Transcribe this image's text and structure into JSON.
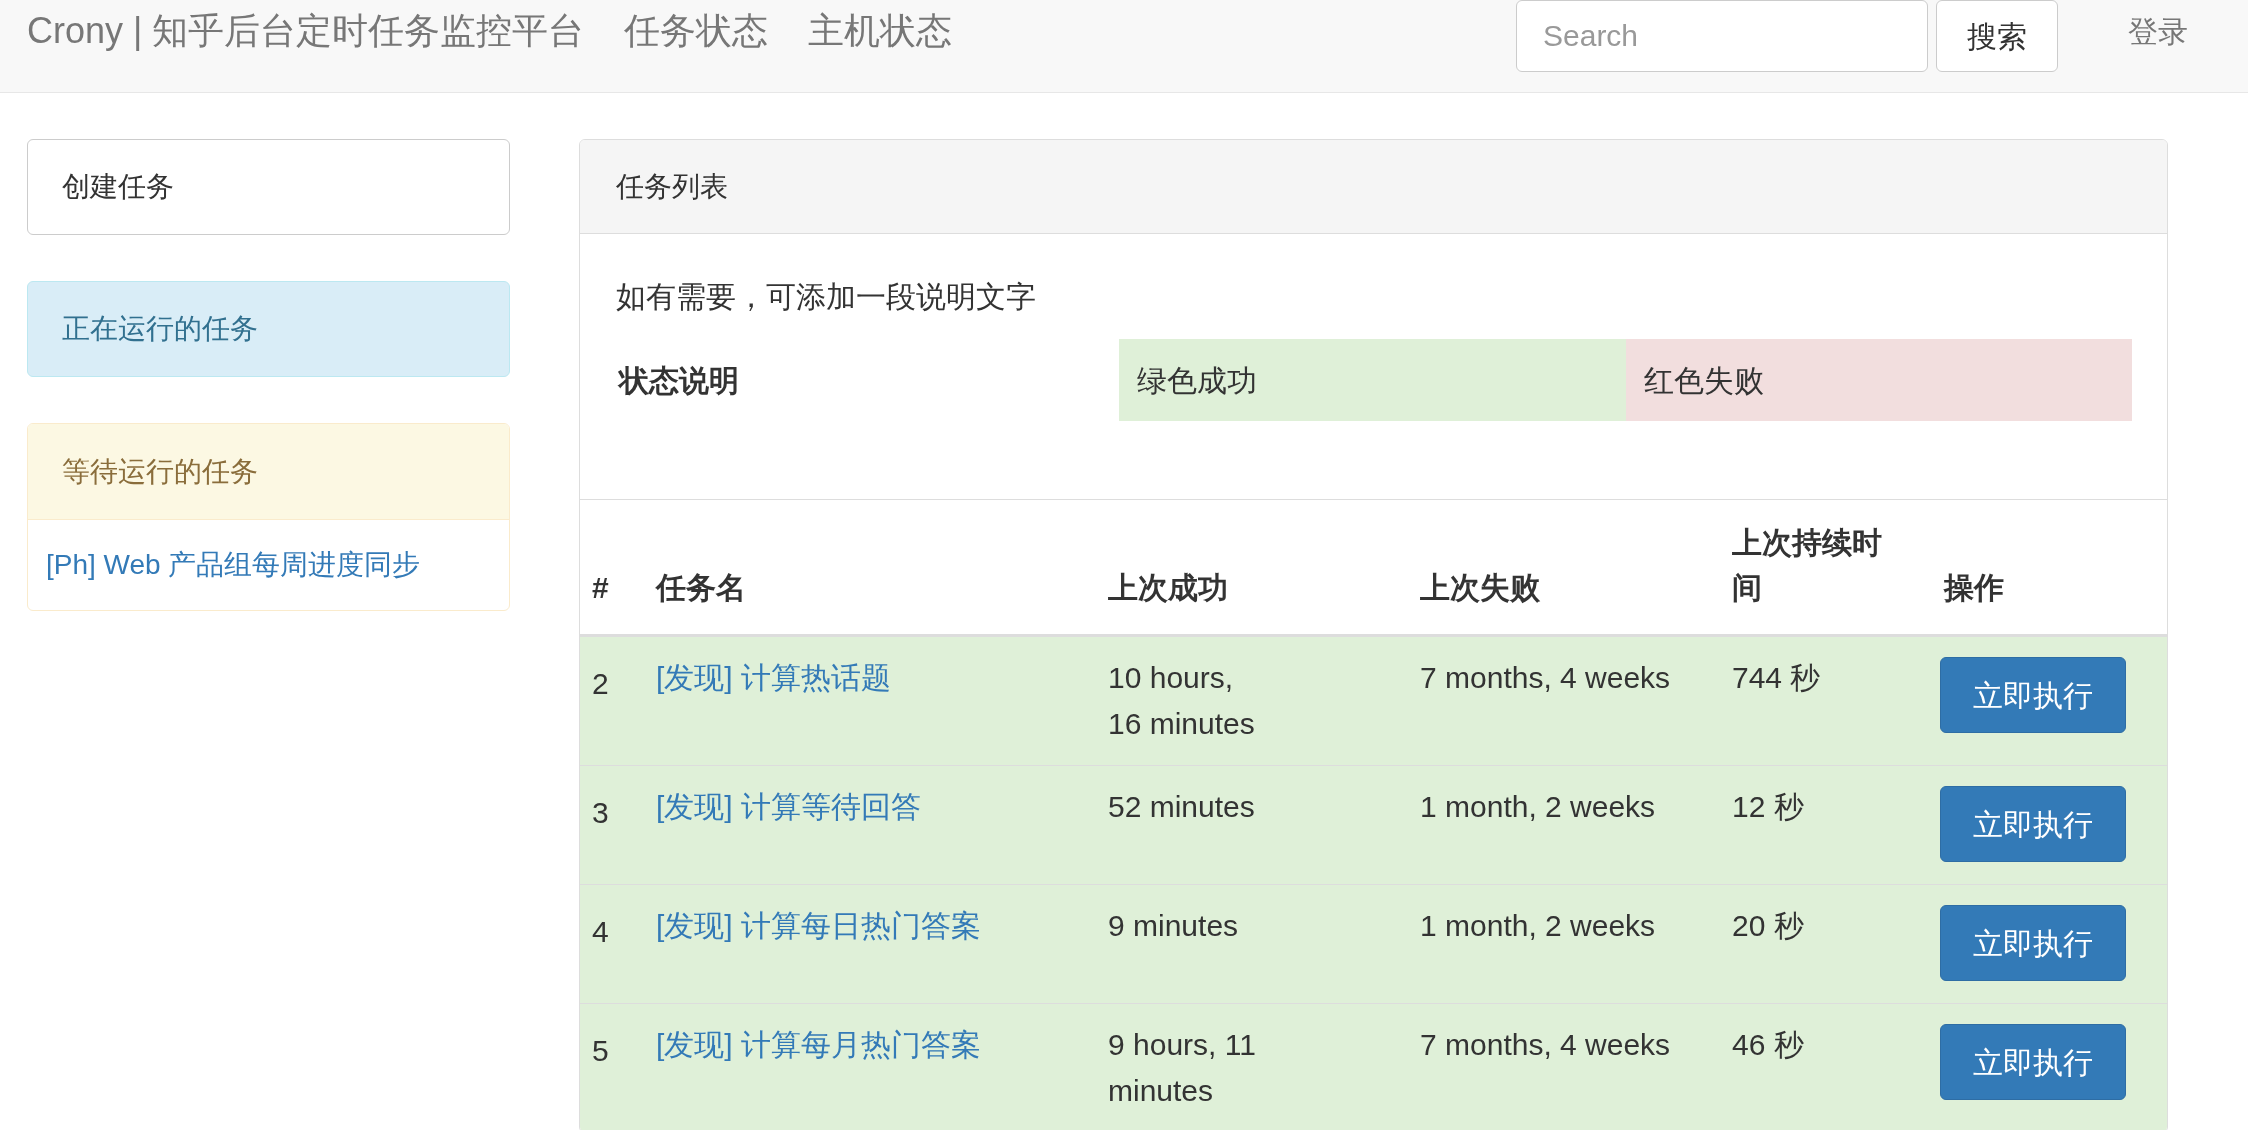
{
  "navbar": {
    "brand": "Crony | 知乎后台定时任务监控平台",
    "links": [
      "任务状态",
      "主机状态"
    ],
    "search": {
      "placeholder": "Search"
    },
    "search_button": "搜索",
    "login": "登录"
  },
  "sidebar": {
    "items": [
      {
        "kind": "button",
        "label": "创建任务"
      },
      {
        "kind": "info",
        "label": "正在运行的任务"
      },
      {
        "kind": "warning",
        "label": "等待运行的任务",
        "children": [
          "[Ph] Web 产品组每周进度同步"
        ]
      }
    ]
  },
  "panel": {
    "title": "任务列表",
    "description": "如有需要，可添加一段说明文字",
    "legend": {
      "label": "状态说明",
      "items": [
        {
          "label": "绿色成功",
          "color": "#dff0d8"
        },
        {
          "label": "红色失败",
          "color": "#f2dede"
        }
      ]
    },
    "table": {
      "columns": [
        "#",
        "任务名",
        "上次成功",
        "上次失败",
        "上次持续时间",
        "操作"
      ],
      "rows": [
        {
          "color": "#dff0d8",
          "number": "2",
          "name": "[发现] 计算热话题",
          "last_success": "10 hours, 16 minutes",
          "last_failure": "7 months, 4 weeks",
          "duration": "744 秒",
          "action": "立即执行"
        },
        {
          "color": "#dff0d8",
          "number": "3",
          "name": "[发现] 计算等待回答",
          "last_success": "52 minutes",
          "last_failure": "1 month, 2 weeks",
          "duration": "12 秒",
          "action": "立即执行"
        },
        {
          "color": "#dff0d8",
          "number": "4",
          "name": "[发现] 计算每日热门答案",
          "last_success": "9 minutes",
          "last_failure": "1 month, 2 weeks",
          "duration": "20 秒",
          "action": "立即执行"
        },
        {
          "color": "#dff0d8",
          "number": "5",
          "name": "[发现] 计算每月热门答案",
          "last_success": "9 hours, 11 minutes",
          "last_failure": "7 months, 4 weeks",
          "duration": "46 秒",
          "action": "立即执行"
        }
      ]
    }
  }
}
